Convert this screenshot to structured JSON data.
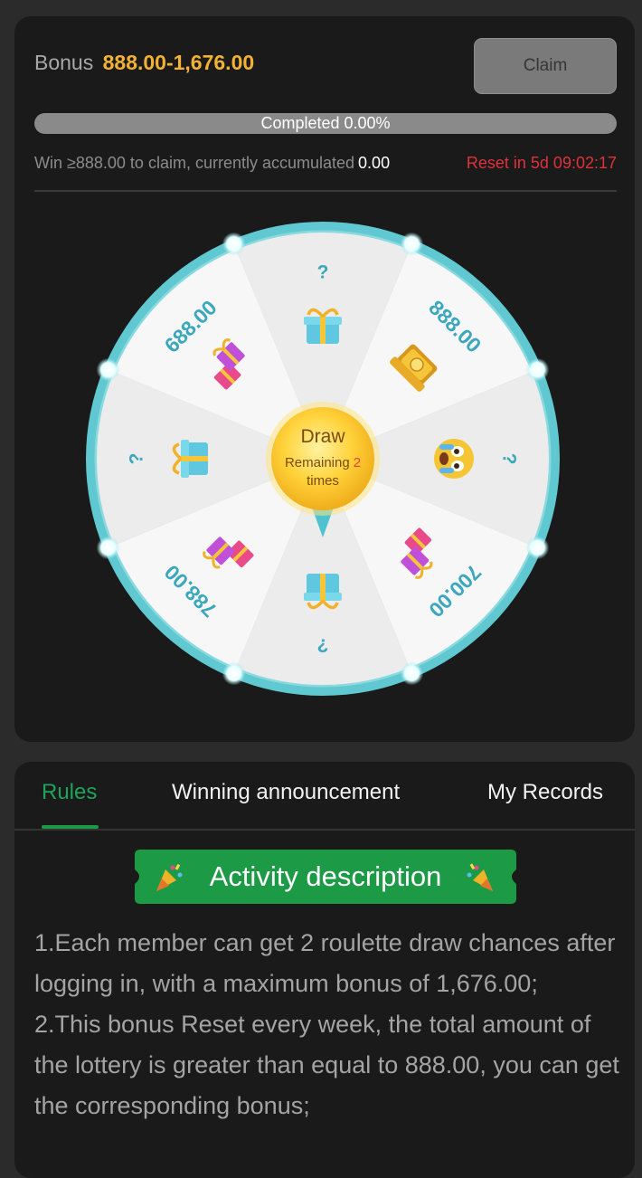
{
  "bonus": {
    "label": "Bonus",
    "range": "888.00-1,676.00",
    "claim_label": "Claim"
  },
  "progress": {
    "text": "Completed 0.00%",
    "fraction": 0.0,
    "win_text": "Win ≥888.00 to claim, currently accumulated",
    "accumulated": "0.00",
    "reset_text": "Reset in 5d 09:02:17"
  },
  "wheel": {
    "segments": [
      {
        "label": "?",
        "icon": "gift-box-icon"
      },
      {
        "label": "888.00",
        "icon": "gold-bars-icon"
      },
      {
        "label": "?",
        "icon": "crying-face-icon"
      },
      {
        "label": "700.00",
        "icon": "gift-boxes-icon"
      },
      {
        "label": "?",
        "icon": "gift-box-icon"
      },
      {
        "label": "788.00",
        "icon": "gift-boxes-icon"
      },
      {
        "label": "?",
        "icon": "gift-box-icon"
      },
      {
        "label": "688.00",
        "icon": "gift-boxes-icon"
      }
    ],
    "draw_label": "Draw",
    "remaining_prefix": "Remaining",
    "remaining_count": "2",
    "remaining_suffix": "times",
    "colors": {
      "rim": "#5fc8d0",
      "segment_light": "#f7f7f7",
      "segment_dark": "#ececec",
      "label": "#3aa7bd",
      "center": "#f7c52a"
    }
  },
  "tabs": [
    {
      "label": "Rules",
      "active": true
    },
    {
      "label": "Winning announcement",
      "active": false
    },
    {
      "label": "My Records",
      "active": false
    }
  ],
  "activity": {
    "title": "Activity description",
    "paragraphs": [
      "1.Each member can get 2 roulette draw chances after logging in, with a maximum bonus of 1,676.00;",
      "2.This bonus Reset every week, the total amount of the lottery is greater than equal to 888.00, you can get the corresponding bonus;"
    ]
  },
  "colors": {
    "accent_green": "#1c9a45",
    "bonus_gold": "#f2b233",
    "reset_red": "#e0323a"
  }
}
